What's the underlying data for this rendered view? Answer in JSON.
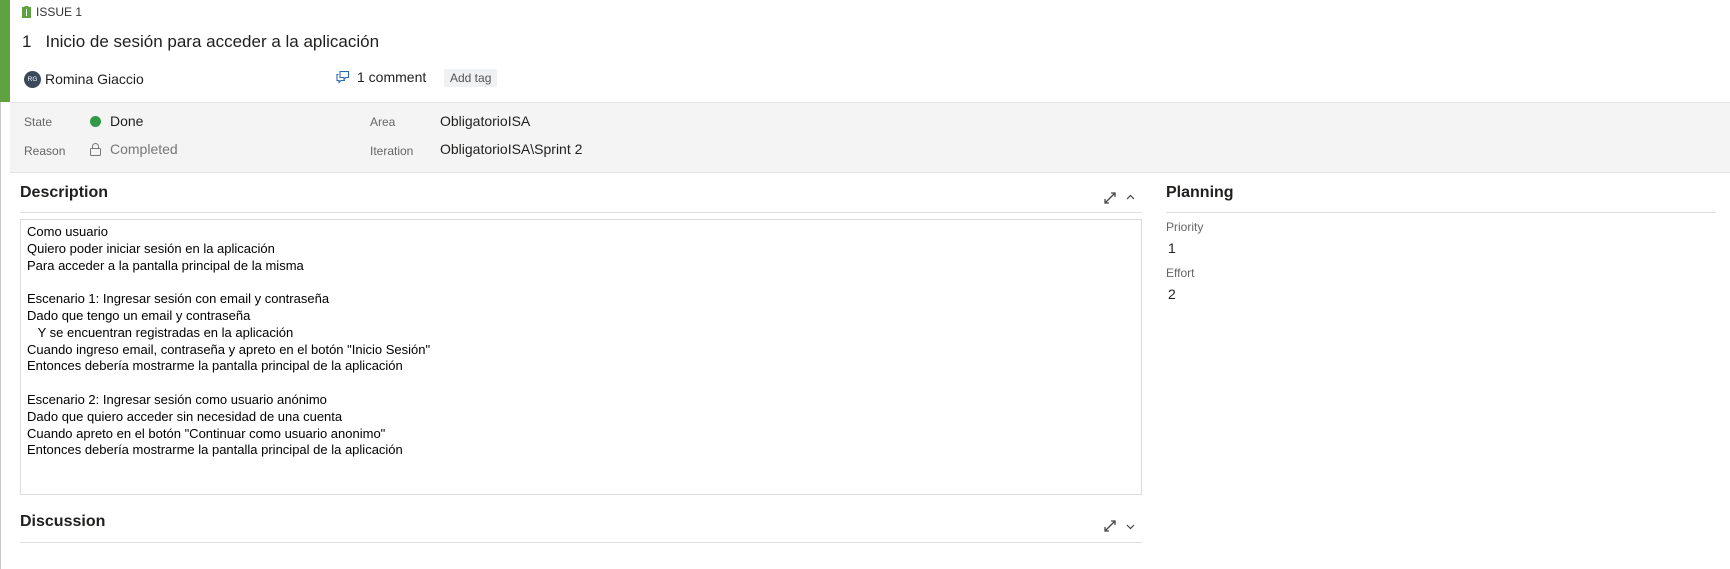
{
  "colors": {
    "accent": "#5fa341",
    "done_dot": "#339947",
    "fields_bg": "#f4f4f4"
  },
  "header": {
    "type_icon": "issue-icon",
    "type_label": "ISSUE 1",
    "id": "1",
    "title": "Inicio de sesión para acceder a la aplicación",
    "assignee_initials": "RG",
    "assignee_name": "Romina Giaccio",
    "comment_icon": "comment-icon",
    "comments_label": "1 comment",
    "add_tag_label": "Add tag"
  },
  "fields": {
    "state_label": "State",
    "state_value": "Done",
    "reason_label": "Reason",
    "reason_icon": "lock-icon",
    "reason_value": "Completed",
    "area_label": "Area",
    "area_value": "ObligatorioISA",
    "iteration_label": "Iteration",
    "iteration_value": "ObligatorioISA\\Sprint 2"
  },
  "description": {
    "title": "Description",
    "expand_icon": "expand-icon",
    "collapse_icon": "chevron-up-icon",
    "lines": [
      "Como usuario",
      "Quiero poder iniciar sesión en la aplicación",
      "Para acceder a la pantalla principal de la misma",
      "",
      "Escenario 1: Ingresar sesión con email y contraseña",
      "Dado que tengo un email y contraseña",
      "   Y se encuentran registradas en la aplicación",
      "Cuando ingreso email, contraseña y apreto en el botón \"Inicio Sesión\"",
      "Entonces debería mostrarme la pantalla principal de la aplicación",
      "",
      "Escenario 2: Ingresar sesión como usuario anónimo",
      "Dado que quiero acceder sin necesidad de una cuenta",
      "Cuando apreto en el botón \"Continuar como usuario anonimo\"",
      "Entonces debería mostrarme la pantalla principal de la aplicación"
    ]
  },
  "discussion": {
    "title": "Discussion",
    "expand_icon": "expand-icon",
    "toggle_icon": "chevron-down-icon"
  },
  "planning": {
    "title": "Planning",
    "priority_label": "Priority",
    "priority_value": "1",
    "effort_label": "Effort",
    "effort_value": "2"
  }
}
